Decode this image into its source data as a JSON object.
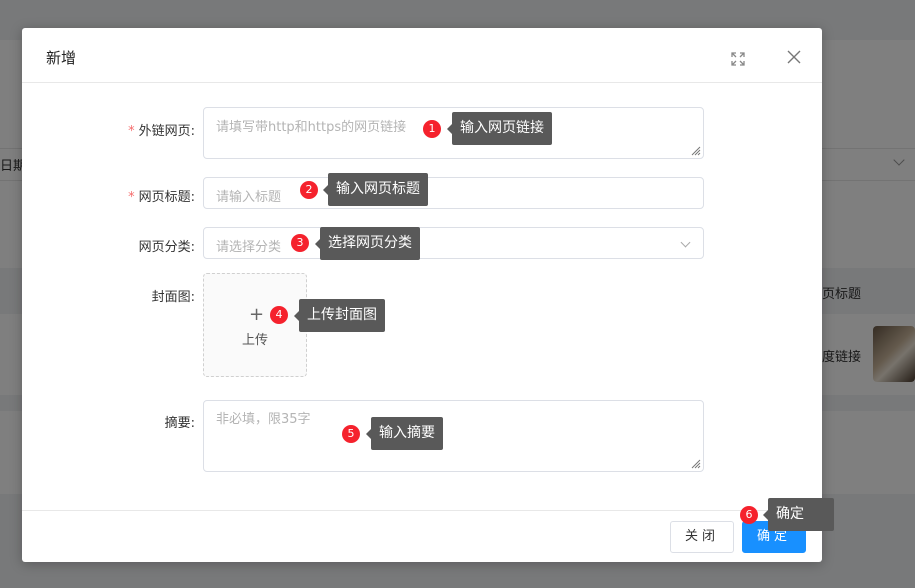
{
  "background": {
    "left_fragment": "日期",
    "right_header": "页标题",
    "right_cell": "度链接"
  },
  "dialog": {
    "title": "新增",
    "fields": {
      "link": {
        "label": "外链网页:",
        "required": true,
        "placeholder": "请填写带http和https的网页链接"
      },
      "title": {
        "label": "网页标题:",
        "required": true,
        "placeholder": "请输入标题"
      },
      "category": {
        "label": "网页分类:",
        "required": false,
        "placeholder": "请选择分类"
      },
      "cover": {
        "label": "封面图:",
        "required": false,
        "upload_label": "上传"
      },
      "summary": {
        "label": "摘要:",
        "required": false,
        "placeholder": "非必填，限35字"
      }
    },
    "required_mark": "*",
    "footer": {
      "close_label": "关闭",
      "ok_label": "确定"
    }
  },
  "guide": [
    {
      "num": "1",
      "text": "输入网页链接"
    },
    {
      "num": "2",
      "text": "输入网页标题"
    },
    {
      "num": "3",
      "text": "选择网页分类"
    },
    {
      "num": "4",
      "text": "上传封面图"
    },
    {
      "num": "5",
      "text": "输入摘要"
    },
    {
      "num": "6",
      "text": "确定"
    }
  ],
  "colors": {
    "primary": "#1890ff",
    "required": "#f56c6c",
    "badge": "#f5222d",
    "tooltip": "#595959"
  },
  "icons": {
    "fullscreen": "fullscreen-icon",
    "close": "close-icon",
    "plus": "plus-icon",
    "select_arrow": "chevron-down-icon"
  }
}
